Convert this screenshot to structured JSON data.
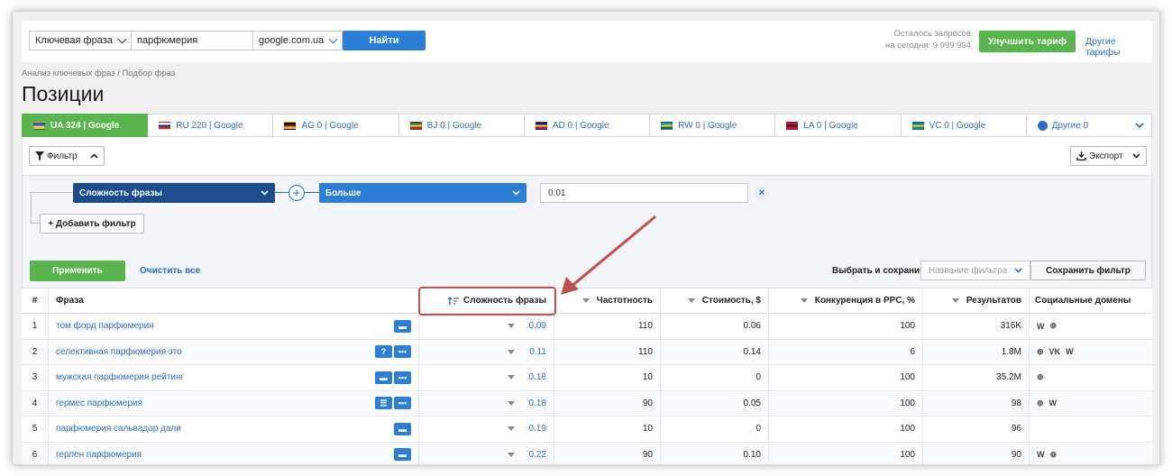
{
  "search": {
    "type_label": "Ключевая фраза",
    "query": "парфюмерия",
    "engine": "google.com.ua",
    "find_label": "Найти",
    "quota_line1": "Осталось запросов",
    "quota_line2": "на сегодня: 9 999 994",
    "upgrade_label": "Улучшить тариф",
    "other_plans_label": "Другие тарифы"
  },
  "breadcrumb": "Анализ ключевых фраз / Подбор фраз",
  "page_title": "Позиции",
  "tabs": [
    {
      "label": "UA 324 | Google",
      "flag": [
        "#2a5bd7",
        "#f7d117"
      ]
    },
    {
      "label": "RU 220 | Google",
      "flag": [
        "#ffffff",
        "#0039a6",
        "#d52b1e"
      ]
    },
    {
      "label": "AG 0 | Google",
      "flag": [
        "#000000",
        "#ce1126",
        "#fcd116"
      ]
    },
    {
      "label": "BJ 0 | Google",
      "flag": [
        "#008751",
        "#fcd116",
        "#e8112d"
      ]
    },
    {
      "label": "AD 0 | Google",
      "flag": [
        "#0018a8",
        "#fedf00",
        "#d0103a"
      ]
    },
    {
      "label": "RW 0 | Google",
      "flag": [
        "#00a1de",
        "#fad201",
        "#20603d"
      ]
    },
    {
      "label": "LA 0 | Google",
      "flag": [
        "#ce1126",
        "#002868",
        "#ce1126"
      ]
    },
    {
      "label": "VC 0 | Google",
      "flag": [
        "#0072c6",
        "#fcd116",
        "#009e60"
      ]
    },
    {
      "label": "Другие 0",
      "flag": []
    }
  ],
  "toolbar": {
    "filter_label": "Фильтр",
    "export_label": "Экспорт"
  },
  "filter": {
    "field": "Сложность фразы",
    "operator": "Больше",
    "value": "0.01",
    "add_filter_label": "+ Добавить фильтр",
    "apply_label": "Применить",
    "clear_label": "Очистить все",
    "choose_save_label": "Выбрать и сохранить",
    "filter_name_placeholder": "Название фильтра",
    "save_filter_label": "Сохранить фильтр"
  },
  "table": {
    "headers": {
      "num": "#",
      "phrase": "Фраза",
      "difficulty": "Сложность фразы",
      "frequency": "Частотность",
      "cost": "Стоимость, $",
      "competition": "Конкуренция в PPC, %",
      "results": "Результатов",
      "social": "Социальные домены"
    },
    "rows": [
      {
        "num": "1",
        "phrase": "том форд парфюмерия",
        "difficulty": "0.09",
        "frequency": "110",
        "cost": "0.06",
        "competition": "100",
        "results": "316K",
        "icons": [
          "chat"
        ],
        "social": [
          "W",
          "P"
        ]
      },
      {
        "num": "2",
        "phrase": "селективная парфюмерия это",
        "difficulty": "0.11",
        "frequency": "110",
        "cost": "0.14",
        "competition": "6",
        "results": "1.8M",
        "icons": [
          "question",
          "more"
        ],
        "social": [
          "P",
          "VK",
          "W"
        ]
      },
      {
        "num": "3",
        "phrase": "мужская парфюмерия рейтинг",
        "difficulty": "0.18",
        "frequency": "10",
        "cost": "0",
        "competition": "100",
        "results": "35.2M",
        "icons": [
          "chat",
          "more"
        ],
        "social": [
          "P"
        ]
      },
      {
        "num": "4",
        "phrase": "гермес парфюмерия",
        "difficulty": "0.18",
        "frequency": "90",
        "cost": "0.05",
        "competition": "100",
        "results": "98",
        "icons": [
          "list",
          "more"
        ],
        "social": [
          "P",
          "W"
        ]
      },
      {
        "num": "5",
        "phrase": "парфюмерия сальвадор дали",
        "difficulty": "0.19",
        "frequency": "10",
        "cost": "0",
        "competition": "100",
        "results": "96",
        "icons": [
          "chat"
        ],
        "social": []
      },
      {
        "num": "6",
        "phrase": "герлен парфюмерия",
        "difficulty": "0.22",
        "frequency": "90",
        "cost": "0.10",
        "competition": "100",
        "results": "90",
        "icons": [
          "chat"
        ],
        "social": [
          "W",
          "P"
        ]
      }
    ]
  },
  "colors": {
    "accent_blue": "#2d7ed6",
    "accent_green": "#5bb54e",
    "dark_blue": "#1b4d8c",
    "annotation_red": "#c0504d"
  }
}
